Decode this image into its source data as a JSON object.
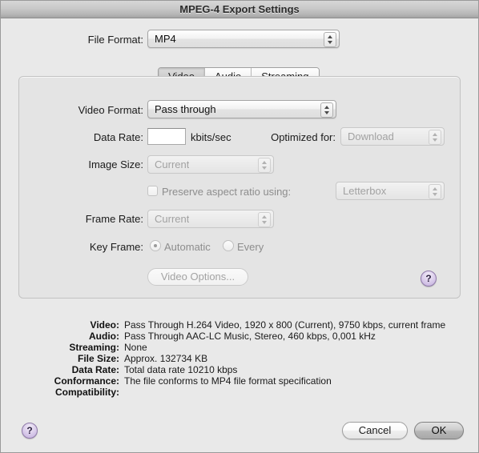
{
  "window": {
    "title": "MPEG-4 Export Settings"
  },
  "file_format": {
    "label": "File Format:",
    "value": "MP4"
  },
  "tabs": [
    {
      "label": "Video",
      "selected": true
    },
    {
      "label": "Audio",
      "selected": false
    },
    {
      "label": "Streaming",
      "selected": false
    }
  ],
  "video_panel": {
    "video_format": {
      "label": "Video Format:",
      "value": "Pass through"
    },
    "data_rate": {
      "label": "Data Rate:",
      "value": "",
      "units": "kbits/sec"
    },
    "optimized_for": {
      "label": "Optimized for:",
      "value": "Download"
    },
    "image_size": {
      "label": "Image Size:",
      "value": "Current"
    },
    "preserve_aspect": {
      "label": "Preserve aspect ratio using:",
      "checked": false,
      "mode_value": "Letterbox"
    },
    "frame_rate": {
      "label": "Frame Rate:",
      "value": "Current"
    },
    "key_frame": {
      "label": "Key Frame:",
      "automatic_label": "Automatic",
      "every_label": "Every",
      "selected": "Automatic"
    },
    "video_options_button": "Video Options...",
    "help_glyph": "?"
  },
  "summary": {
    "rows": [
      {
        "key": "Video:",
        "value": "Pass Through H.264 Video, 1920 x 800 (Current), 9750 kbps, current frame"
      },
      {
        "key": "Audio:",
        "value": "Pass Through AAC-LC Music, Stereo, 460 kbps, 0,001 kHz"
      },
      {
        "key": "Streaming:",
        "value": "None"
      },
      {
        "key": "File Size:",
        "value": "Approx. 132734 KB"
      },
      {
        "key": "Data Rate:",
        "value": "Total data rate 10210 kbps"
      },
      {
        "key": "Conformance:",
        "value": "The file conforms to MP4 file format specification"
      },
      {
        "key": "Compatibility:",
        "value": ""
      }
    ]
  },
  "footer": {
    "help_glyph": "?",
    "cancel_label": "Cancel",
    "ok_label": "OK"
  },
  "colors": {
    "accent_help": "#c2aedd",
    "window_bg": "#e9e9e9",
    "group_bg": "#e4e4e4"
  }
}
